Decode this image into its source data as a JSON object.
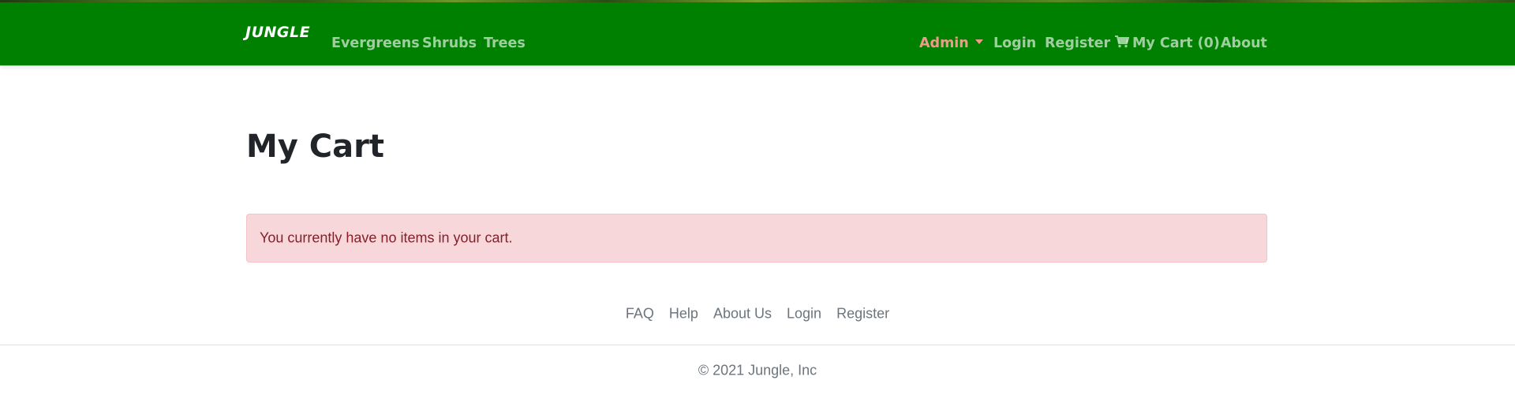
{
  "navbar": {
    "brand": "JUNGLE",
    "left_links": [
      "Evergreens",
      "Shrubs",
      "Trees"
    ],
    "admin": "Admin",
    "login": "Login",
    "register": "Register",
    "cart": "My Cart (0)",
    "about": "About",
    "colors": {
      "background": "#008000",
      "admin": "#f1998b"
    }
  },
  "main": {
    "title": "My Cart",
    "alert": "You currently have no items in your cart."
  },
  "footer": {
    "links": [
      "FAQ",
      "Help",
      "About Us",
      "Login",
      "Register"
    ],
    "copyright": "© 2021 Jungle, Inc"
  },
  "icons": {
    "cart": "shopping-cart-icon",
    "caret": "caret-down-icon"
  }
}
